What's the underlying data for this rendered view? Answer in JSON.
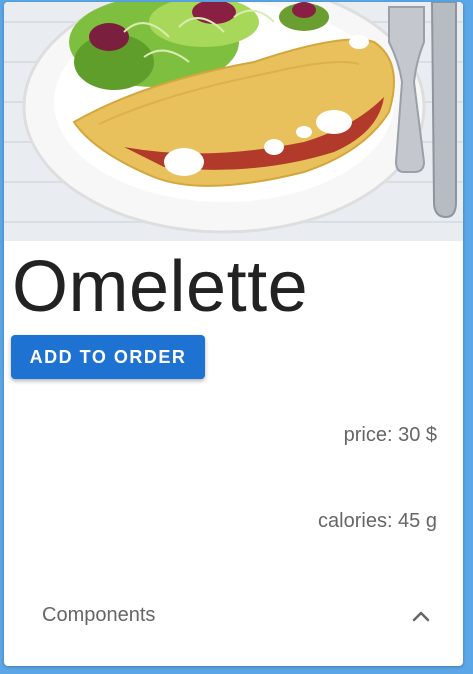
{
  "dish": {
    "name": "Omelette",
    "image_icon": "omelette-photo"
  },
  "actions": {
    "add_label": "ADD TO ORDER"
  },
  "details": {
    "price": "price: 30 $",
    "calories": "calories: 45 g"
  },
  "components": {
    "label": "Components",
    "expand_icon": "chevron-up-icon"
  },
  "colors": {
    "accent": "#1e73d2",
    "frame": "#5aa6e6",
    "title_text": "#222222",
    "secondary_text": "#666666"
  }
}
